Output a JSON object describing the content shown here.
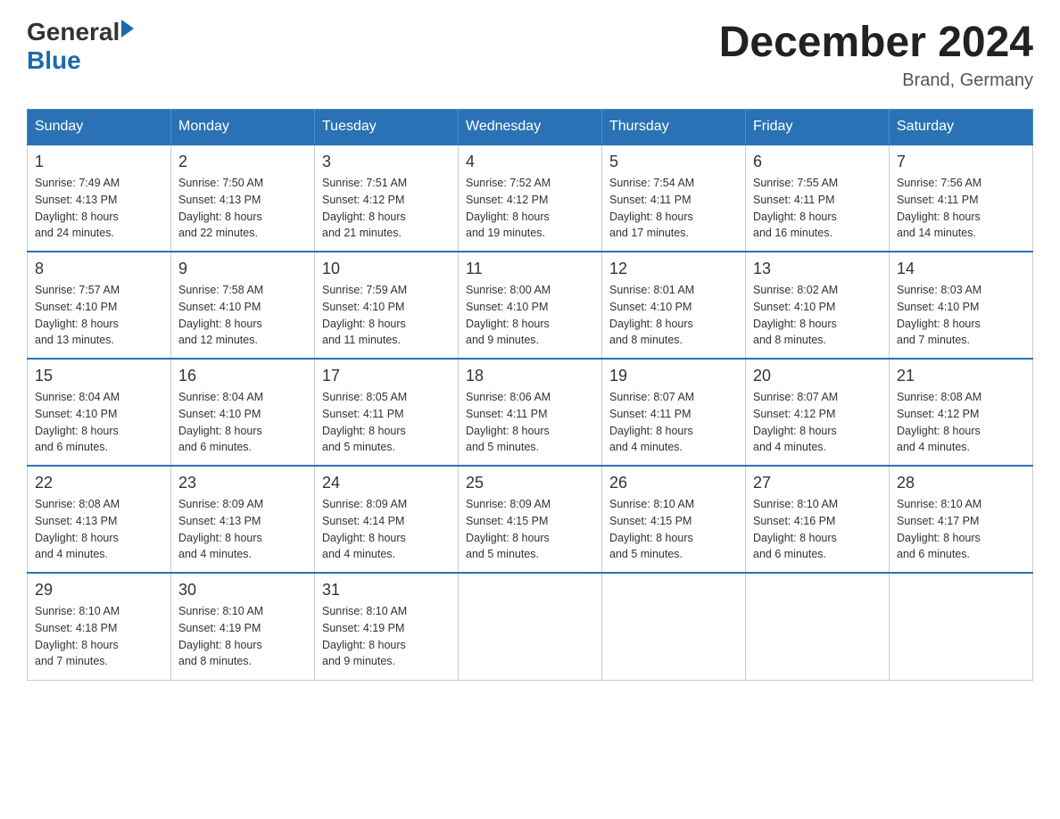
{
  "header": {
    "logo_general": "General",
    "logo_blue": "Blue",
    "month_title": "December 2024",
    "location": "Brand, Germany"
  },
  "days_of_week": [
    "Sunday",
    "Monday",
    "Tuesday",
    "Wednesday",
    "Thursday",
    "Friday",
    "Saturday"
  ],
  "weeks": [
    [
      {
        "day": "1",
        "sunrise": "7:49 AM",
        "sunset": "4:13 PM",
        "daylight": "8 hours and 24 minutes."
      },
      {
        "day": "2",
        "sunrise": "7:50 AM",
        "sunset": "4:13 PM",
        "daylight": "8 hours and 22 minutes."
      },
      {
        "day": "3",
        "sunrise": "7:51 AM",
        "sunset": "4:12 PM",
        "daylight": "8 hours and 21 minutes."
      },
      {
        "day": "4",
        "sunrise": "7:52 AM",
        "sunset": "4:12 PM",
        "daylight": "8 hours and 19 minutes."
      },
      {
        "day": "5",
        "sunrise": "7:54 AM",
        "sunset": "4:11 PM",
        "daylight": "8 hours and 17 minutes."
      },
      {
        "day": "6",
        "sunrise": "7:55 AM",
        "sunset": "4:11 PM",
        "daylight": "8 hours and 16 minutes."
      },
      {
        "day": "7",
        "sunrise": "7:56 AM",
        "sunset": "4:11 PM",
        "daylight": "8 hours and 14 minutes."
      }
    ],
    [
      {
        "day": "8",
        "sunrise": "7:57 AM",
        "sunset": "4:10 PM",
        "daylight": "8 hours and 13 minutes."
      },
      {
        "day": "9",
        "sunrise": "7:58 AM",
        "sunset": "4:10 PM",
        "daylight": "8 hours and 12 minutes."
      },
      {
        "day": "10",
        "sunrise": "7:59 AM",
        "sunset": "4:10 PM",
        "daylight": "8 hours and 11 minutes."
      },
      {
        "day": "11",
        "sunrise": "8:00 AM",
        "sunset": "4:10 PM",
        "daylight": "8 hours and 9 minutes."
      },
      {
        "day": "12",
        "sunrise": "8:01 AM",
        "sunset": "4:10 PM",
        "daylight": "8 hours and 8 minutes."
      },
      {
        "day": "13",
        "sunrise": "8:02 AM",
        "sunset": "4:10 PM",
        "daylight": "8 hours and 8 minutes."
      },
      {
        "day": "14",
        "sunrise": "8:03 AM",
        "sunset": "4:10 PM",
        "daylight": "8 hours and 7 minutes."
      }
    ],
    [
      {
        "day": "15",
        "sunrise": "8:04 AM",
        "sunset": "4:10 PM",
        "daylight": "8 hours and 6 minutes."
      },
      {
        "day": "16",
        "sunrise": "8:04 AM",
        "sunset": "4:10 PM",
        "daylight": "8 hours and 6 minutes."
      },
      {
        "day": "17",
        "sunrise": "8:05 AM",
        "sunset": "4:11 PM",
        "daylight": "8 hours and 5 minutes."
      },
      {
        "day": "18",
        "sunrise": "8:06 AM",
        "sunset": "4:11 PM",
        "daylight": "8 hours and 5 minutes."
      },
      {
        "day": "19",
        "sunrise": "8:07 AM",
        "sunset": "4:11 PM",
        "daylight": "8 hours and 4 minutes."
      },
      {
        "day": "20",
        "sunrise": "8:07 AM",
        "sunset": "4:12 PM",
        "daylight": "8 hours and 4 minutes."
      },
      {
        "day": "21",
        "sunrise": "8:08 AM",
        "sunset": "4:12 PM",
        "daylight": "8 hours and 4 minutes."
      }
    ],
    [
      {
        "day": "22",
        "sunrise": "8:08 AM",
        "sunset": "4:13 PM",
        "daylight": "8 hours and 4 minutes."
      },
      {
        "day": "23",
        "sunrise": "8:09 AM",
        "sunset": "4:13 PM",
        "daylight": "8 hours and 4 minutes."
      },
      {
        "day": "24",
        "sunrise": "8:09 AM",
        "sunset": "4:14 PM",
        "daylight": "8 hours and 4 minutes."
      },
      {
        "day": "25",
        "sunrise": "8:09 AM",
        "sunset": "4:15 PM",
        "daylight": "8 hours and 5 minutes."
      },
      {
        "day": "26",
        "sunrise": "8:10 AM",
        "sunset": "4:15 PM",
        "daylight": "8 hours and 5 minutes."
      },
      {
        "day": "27",
        "sunrise": "8:10 AM",
        "sunset": "4:16 PM",
        "daylight": "8 hours and 6 minutes."
      },
      {
        "day": "28",
        "sunrise": "8:10 AM",
        "sunset": "4:17 PM",
        "daylight": "8 hours and 6 minutes."
      }
    ],
    [
      {
        "day": "29",
        "sunrise": "8:10 AM",
        "sunset": "4:18 PM",
        "daylight": "8 hours and 7 minutes."
      },
      {
        "day": "30",
        "sunrise": "8:10 AM",
        "sunset": "4:19 PM",
        "daylight": "8 hours and 8 minutes."
      },
      {
        "day": "31",
        "sunrise": "8:10 AM",
        "sunset": "4:19 PM",
        "daylight": "8 hours and 9 minutes."
      },
      null,
      null,
      null,
      null
    ]
  ],
  "labels": {
    "sunrise": "Sunrise: ",
    "sunset": "Sunset: ",
    "daylight": "Daylight: "
  }
}
